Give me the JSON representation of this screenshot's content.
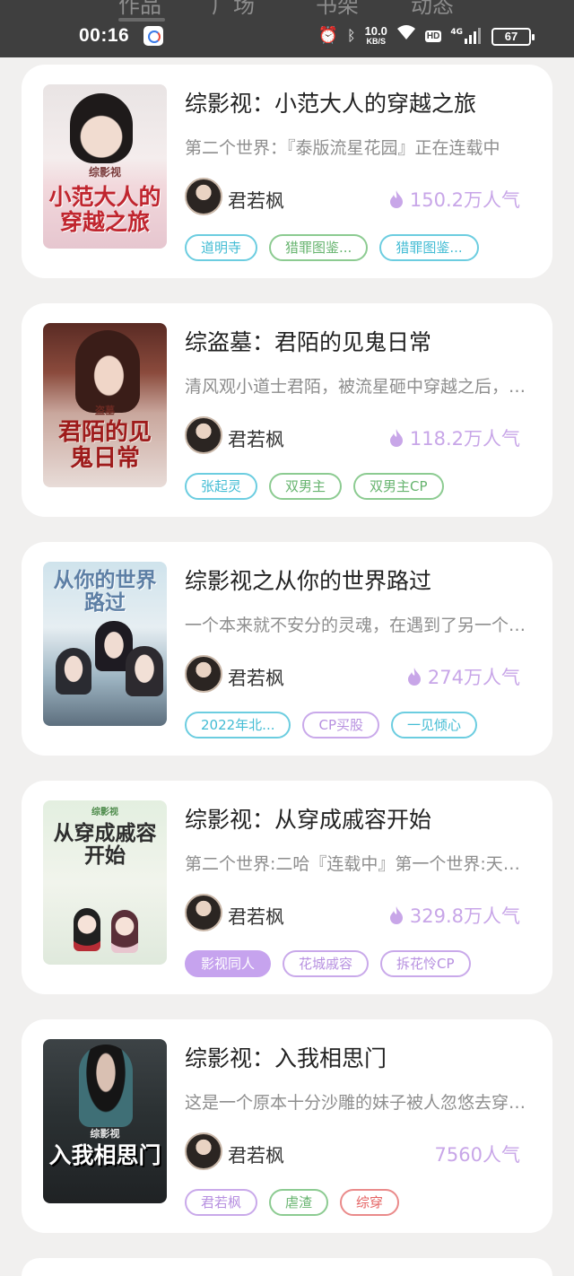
{
  "status_bar": {
    "tabs": [
      "作品",
      "广场",
      "书架",
      "动态"
    ],
    "time": "00:16",
    "net_speed_value": "10.0",
    "net_speed_unit": "KB/S",
    "hd": "HD",
    "network_type": "4G",
    "battery": "67"
  },
  "works": [
    {
      "title": "综影视：小范大人的穿越之旅",
      "description": "第二个世界：『泰版流星花园』正在连载中",
      "author": "君若枫",
      "popularity": "150.2万人气",
      "flame": true,
      "cover_text": "小范大人的穿越之旅",
      "cover_subtitle": "综影视",
      "tags": [
        {
          "label": "道明寺",
          "style": "cyan"
        },
        {
          "label": "猎罪图鉴...",
          "style": "green"
        },
        {
          "label": "猎罪图鉴...",
          "style": "cyan"
        }
      ]
    },
    {
      "title": "综盗墓：君陌的见鬼日常",
      "description": "清风观小道士君陌，被流星砸中穿越之后，开启了见鬼日常",
      "author": "君若枫",
      "popularity": "118.2万人气",
      "flame": true,
      "cover_text": "君陌的见鬼日常",
      "cover_subtitle": "盗墓",
      "tags": [
        {
          "label": "张起灵",
          "style": "cyan"
        },
        {
          "label": "双男主",
          "style": "green"
        },
        {
          "label": "双男主CP",
          "style": "green"
        }
      ]
    },
    {
      "title": "综影视之从你的世界路过",
      "description": "一个本来就不安分的灵魂，在遇到了另一个灵魂之后",
      "author": "君若枫",
      "popularity": "274万人气",
      "flame": true,
      "cover_text": "从你的世界路过",
      "cover_subtitle": "",
      "tags": [
        {
          "label": "2022年北...",
          "style": "cyan"
        },
        {
          "label": "CP买股",
          "style": "purple"
        },
        {
          "label": "一见倾心",
          "style": "cyan"
        }
      ]
    },
    {
      "title": "综影视：从穿成戚容开始",
      "description": "第二个世界:二哈『连载中』第一个世界:天官赐福",
      "author": "君若枫",
      "popularity": "329.8万人气",
      "flame": true,
      "cover_text": "从穿成戚容开始",
      "cover_subtitle": "综影视",
      "tags": [
        {
          "label": "影视同人",
          "style": "purplefill"
        },
        {
          "label": "花城戚容",
          "style": "purple"
        },
        {
          "label": "拆花怜CP",
          "style": "purple"
        }
      ]
    },
    {
      "title": "综影视：入我相思门",
      "description": "这是一个原本十分沙雕的妹子被人忽悠去穿越的故事",
      "author": "君若枫",
      "popularity": "7560人气",
      "flame": false,
      "cover_text": "入我相思门",
      "cover_subtitle": "综影视",
      "tags": [
        {
          "label": "君若枫",
          "style": "purple"
        },
        {
          "label": "虐渣",
          "style": "green"
        },
        {
          "label": "综穿",
          "style": "red"
        }
      ]
    }
  ]
}
